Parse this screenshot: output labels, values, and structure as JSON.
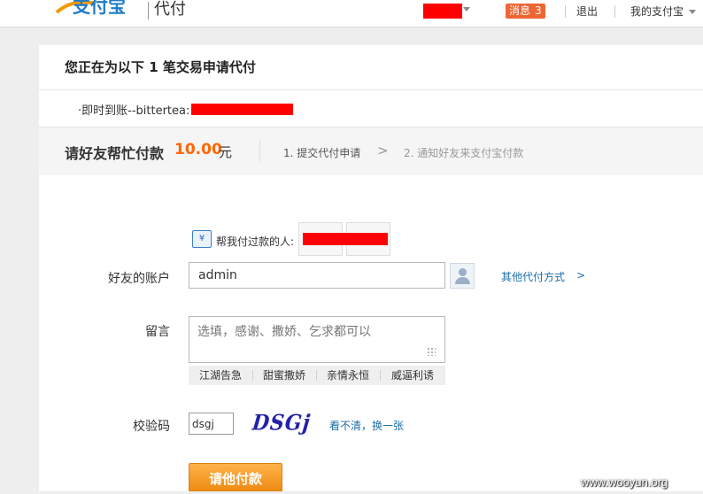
{
  "topbar": {
    "product_name": "代付",
    "messages_label": "消息",
    "messages_count": "3",
    "logout_label": "退出",
    "my_alipay_label": "我的支付宝"
  },
  "order": {
    "title": "您正在为以下 1 笔交易申请代付",
    "item_prefix": "·即时到账--bittertea:"
  },
  "request": {
    "title": "请好友帮忙付款",
    "amount": "10.00",
    "unit": "元",
    "step1": "1. 提交代付申请",
    "step_arrow": ">",
    "step2": "2. 通知好友来支付宝付款"
  },
  "form": {
    "payer_label": "帮我付过款的人:",
    "account_label": "好友的账户",
    "account_value": "admin",
    "other_methods": "其他代付方式",
    "other_arrow": ">",
    "message_label": "留言",
    "message_placeholder": "选填，感谢、撒娇、乞求都可以",
    "quick_phrases": [
      "江湖告急",
      "甜蜜撒娇",
      "亲情永恒",
      "威逼利诱"
    ],
    "captcha_label": "校验码",
    "captcha_value": "dsgj",
    "captcha_image_text": "DSGj",
    "captcha_refresh": "看不清，换一张",
    "submit_label": "请他付款"
  },
  "watermark": "www.wooyun.org",
  "colors": {
    "accent_orange": "#ff6600",
    "link_blue": "#1a6ea8",
    "badge": "#ee6633",
    "redaction": "#ff0000"
  }
}
